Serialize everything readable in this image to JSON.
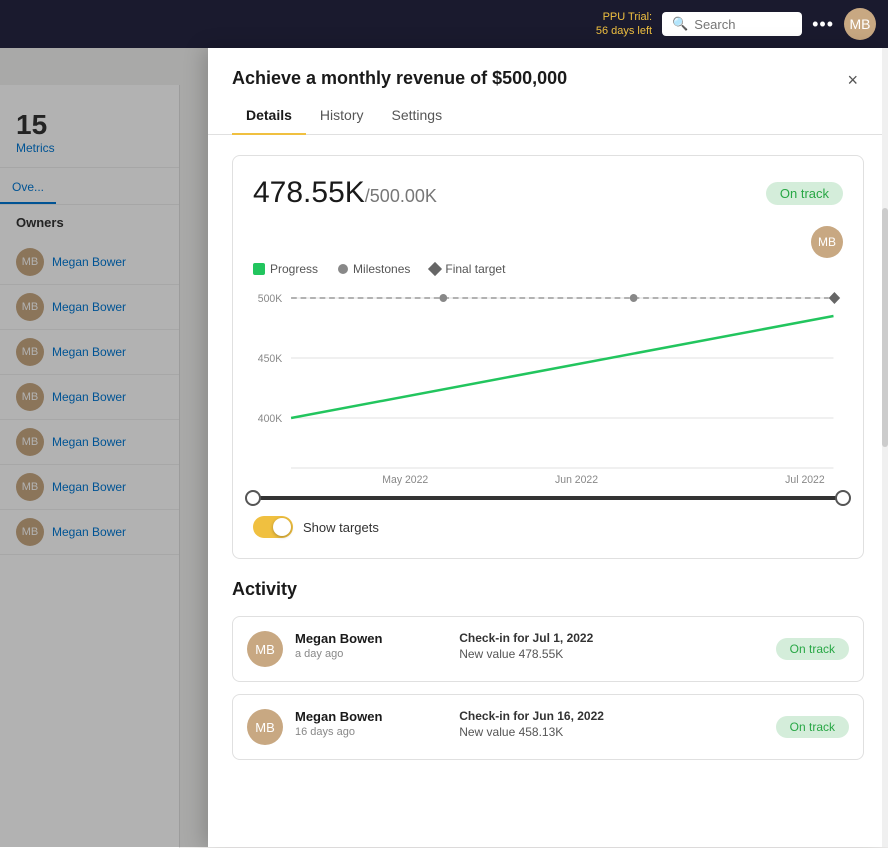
{
  "topbar": {
    "trial_line1": "PPU Trial:",
    "trial_line2": "56 days left",
    "search_placeholder": "Search",
    "search_label": "Search",
    "dots_label": "•••",
    "avatar_initial": "MB"
  },
  "refresh_icon": "↻",
  "left_panel": {
    "metrics_number": "15",
    "metrics_label": "Metrics",
    "tab_overview": "Ove...",
    "owners_header": "Owners",
    "owners": [
      {
        "name": "Megan Bower"
      },
      {
        "name": "Megan Bower"
      },
      {
        "name": "Megan Bower"
      },
      {
        "name": "Megan Bower"
      },
      {
        "name": "Megan Bower"
      },
      {
        "name": "Megan Bower"
      },
      {
        "name": "Megan Bower"
      }
    ]
  },
  "modal": {
    "title": "Achieve a monthly revenue of $500,000",
    "close_label": "×",
    "tabs": [
      {
        "label": "Details",
        "active": true
      },
      {
        "label": "History",
        "active": false
      },
      {
        "label": "Settings",
        "active": false
      }
    ],
    "metric": {
      "current_value": "478.55K",
      "separator": "/",
      "target_value": "500.00K",
      "status": "On track",
      "legend": {
        "progress": "Progress",
        "milestones": "Milestones",
        "final_target": "Final target"
      },
      "chart": {
        "y_labels": [
          "500K",
          "450K",
          "400K"
        ],
        "x_labels": [
          "May 2022",
          "Jun 2022",
          "Jul 2022"
        ],
        "progress_start": 400,
        "progress_end": 478,
        "target_line": 500
      },
      "show_targets_label": "Show targets",
      "user_avatar_initial": "MB"
    },
    "activity": {
      "header": "Activity",
      "items": [
        {
          "name": "Megan Bowen",
          "time": "a day ago",
          "check_title": "Check-in for Jul 1, 2022",
          "check_value": "New value 478.55K",
          "status": "On track"
        },
        {
          "name": "Megan Bowen",
          "time": "16 days ago",
          "check_title": "Check-in for Jun 16, 2022",
          "check_value": "New value 458.13K",
          "status": "On track"
        }
      ]
    }
  }
}
